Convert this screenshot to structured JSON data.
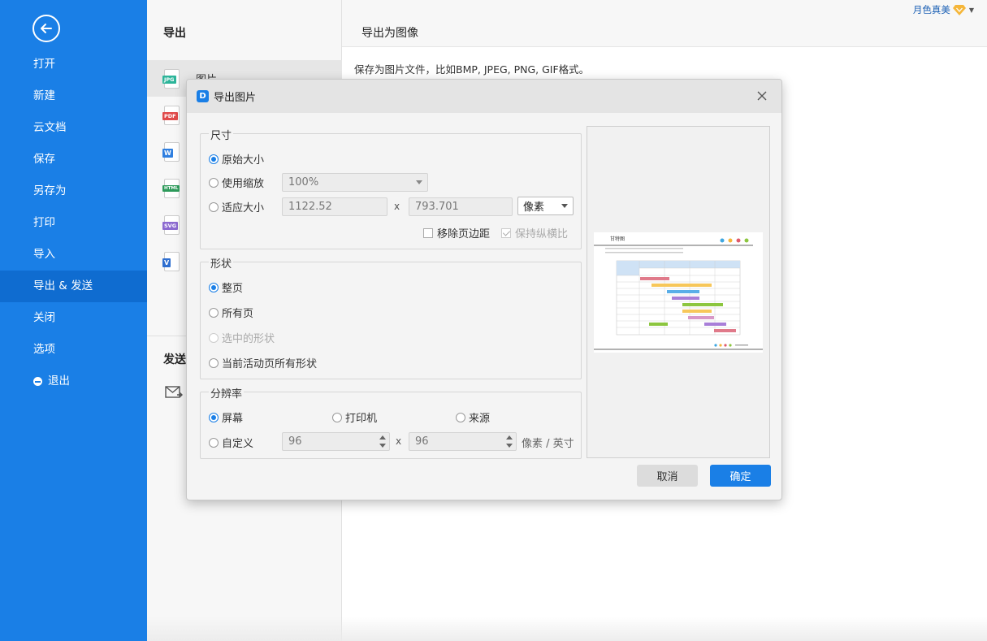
{
  "sidebar": {
    "items": [
      {
        "label": "打开"
      },
      {
        "label": "新建"
      },
      {
        "label": "云文档"
      },
      {
        "label": "保存"
      },
      {
        "label": "另存为"
      },
      {
        "label": "打印"
      },
      {
        "label": "导入"
      },
      {
        "label": "导出 & 发送"
      },
      {
        "label": "关闭"
      },
      {
        "label": "选项"
      },
      {
        "label": "退出"
      }
    ],
    "active_index": 7
  },
  "middle": {
    "export_title": "导出",
    "formats": [
      {
        "tag": "JPG",
        "label": "图片",
        "color": "#2db59a"
      },
      {
        "tag": "PDF",
        "label": "",
        "color": "#e04a4a"
      },
      {
        "tag": "W",
        "label": "",
        "color": "#2f7fe0"
      },
      {
        "tag": "HTML",
        "label": "",
        "color": "#2d9a5a"
      },
      {
        "tag": "SVG",
        "label": "",
        "color": "#8c6ad0"
      },
      {
        "tag": "V",
        "label": "",
        "color": "#2f6fd0"
      }
    ],
    "send_title": "发送"
  },
  "right": {
    "title": "导出为图像",
    "description": "保存为图片文件，比如BMP, JPEG, PNG, GIF格式。",
    "user_name": "月色真美"
  },
  "dialog": {
    "title": "导出图片",
    "size": {
      "group_label": "尺寸",
      "original_label": "原始大小",
      "zoom_label": "使用缩放",
      "zoom_value": "100%",
      "fit_label": "适应大小",
      "width_value": "1122.52",
      "height_value": "793.701",
      "x_sep": "x",
      "unit_value": "像素",
      "remove_margin_label": "移除页边距",
      "keep_ratio_label": "保持纵横比"
    },
    "shape": {
      "group_label": "形状",
      "whole_page": "整页",
      "all_pages": "所有页",
      "selected_shapes": "选中的形状",
      "current_page_shapes": "当前活动页所有形状"
    },
    "resolution": {
      "group_label": "分辨率",
      "screen": "屏幕",
      "printer": "打印机",
      "source": "来源",
      "custom": "自定义",
      "dpi_x": "96",
      "dpi_y": "96",
      "x_sep": "x",
      "unit": "像素 / 英寸"
    },
    "preview": {
      "chart_title": "甘特图"
    },
    "cancel_label": "取消",
    "ok_label": "确定"
  }
}
